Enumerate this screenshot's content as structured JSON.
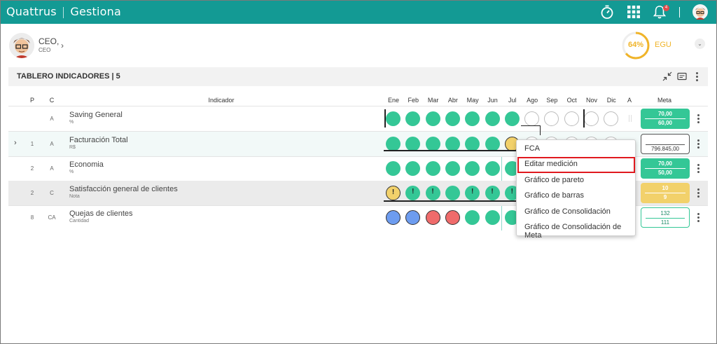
{
  "app": {
    "brand": "Quattrus",
    "module": "Gestiona",
    "notifications_count": "4"
  },
  "icons": {
    "timer": "timer-icon",
    "apps": "apps-grid-icon",
    "bell": "bell-icon",
    "avatar": "avatar"
  },
  "user": {
    "name": "CEO,",
    "role": "CEO"
  },
  "progress": {
    "percent_label": "64%",
    "value": 0.64,
    "unit_label": "EGU"
  },
  "board": {
    "title": "TABLERO INDICADORES | 5"
  },
  "columns": {
    "p": "P",
    "c": "C",
    "indicator": "Indicador",
    "months": [
      "Ene",
      "Feb",
      "Mar",
      "Abr",
      "May",
      "Jun",
      "Jul",
      "Ago",
      "Sep",
      "Oct",
      "Nov",
      "Dic"
    ],
    "a": "A",
    "meta": "Meta"
  },
  "rows": [
    {
      "p": "",
      "c": "A",
      "name": "Saving General",
      "unit": "%",
      "meta_top": "70,00",
      "meta_bottom": "60,00"
    },
    {
      "p": "1",
      "c": "A",
      "name": "Facturación Total",
      "unit": "R$",
      "meta_top": "",
      "meta_bottom": "796.845,00"
    },
    {
      "p": "2",
      "c": "A",
      "name": "Economia",
      "unit": "%",
      "meta_top": "70,00",
      "meta_bottom": "50,00"
    },
    {
      "p": "2",
      "c": "C",
      "name": "Satisfacción general de clientes",
      "unit": "Nota",
      "meta_top": "10",
      "meta_bottom": "9"
    },
    {
      "p": "8",
      "c": "CA",
      "name": "Quejas de clientes",
      "unit": "Cantidad",
      "meta_top": "132",
      "meta_bottom": "111"
    }
  ],
  "statuses": [
    [
      "green",
      "green",
      "green",
      "green",
      "green",
      "green",
      "green",
      "empty",
      "empty",
      "empty",
      "empty",
      "empty"
    ],
    [
      "green",
      "green",
      "green",
      "green",
      "green",
      "green",
      "yellow",
      "empty",
      "empty",
      "empty",
      "empty",
      "empty"
    ],
    [
      "green",
      "green",
      "green",
      "green",
      "green",
      "green",
      "green"
    ],
    [
      "yellow",
      "green",
      "green",
      "green",
      "green",
      "green",
      "green"
    ],
    [
      "blue",
      "blue",
      "red",
      "red",
      "green",
      "green",
      "green"
    ]
  ],
  "colors": {
    "header": "#139a94",
    "green": "#34c796",
    "yellow": "#f2d16b",
    "red": "#ef6b6b",
    "blue": "#6d9cef",
    "highlight": "#e0191f"
  },
  "context_menu": {
    "items": [
      "FCA",
      "Editar medición",
      "Gráfico de pareto",
      "Gráfico de barras",
      "Gráfico de Consolidación",
      "Gráfico de Consolidación de Meta"
    ],
    "highlighted": "Editar medición"
  }
}
